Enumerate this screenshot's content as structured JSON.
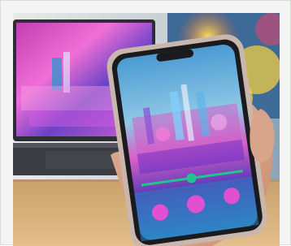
{
  "image": {
    "kind": "photograph",
    "subject": "smartphone",
    "colors": {
      "screen_sky": "#6fb3df",
      "screen_pink": "#e63fb9",
      "screen_purple": "#6b2fc4",
      "slider_green": "#22c58e",
      "button_pink": "#e24fd0",
      "table_wood": "#d8b178",
      "laptop_dark": "#2c2e33",
      "phone_case": "#c9b7ad"
    },
    "icons": [
      "play-button-icon",
      "next-button-icon",
      "previous-button-icon"
    ]
  }
}
